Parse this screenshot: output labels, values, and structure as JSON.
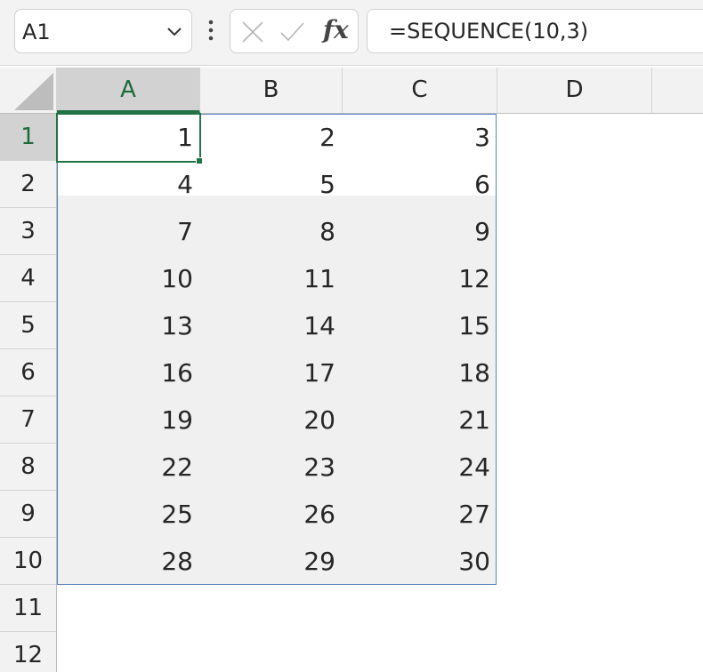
{
  "formula_bar": {
    "name_box": "A1",
    "fx_label": "fx",
    "formula": "=SEQUENCE(10,3)"
  },
  "columns": [
    "A",
    "B",
    "C",
    "D"
  ],
  "rows": [
    "1",
    "2",
    "3",
    "4",
    "5",
    "6",
    "7",
    "8",
    "9",
    "10",
    "11",
    "12"
  ],
  "cells": [
    [
      "1",
      "2",
      "3"
    ],
    [
      "4",
      "5",
      "6"
    ],
    [
      "7",
      "8",
      "9"
    ],
    [
      "10",
      "11",
      "12"
    ],
    [
      "13",
      "14",
      "15"
    ],
    [
      "16",
      "17",
      "18"
    ],
    [
      "19",
      "20",
      "21"
    ],
    [
      "22",
      "23",
      "24"
    ],
    [
      "25",
      "26",
      "27"
    ],
    [
      "28",
      "29",
      "30"
    ]
  ],
  "colors": {
    "accent": "#217346",
    "spill_border": "#5b82c2",
    "spill_fill": "#f0f0f0"
  }
}
